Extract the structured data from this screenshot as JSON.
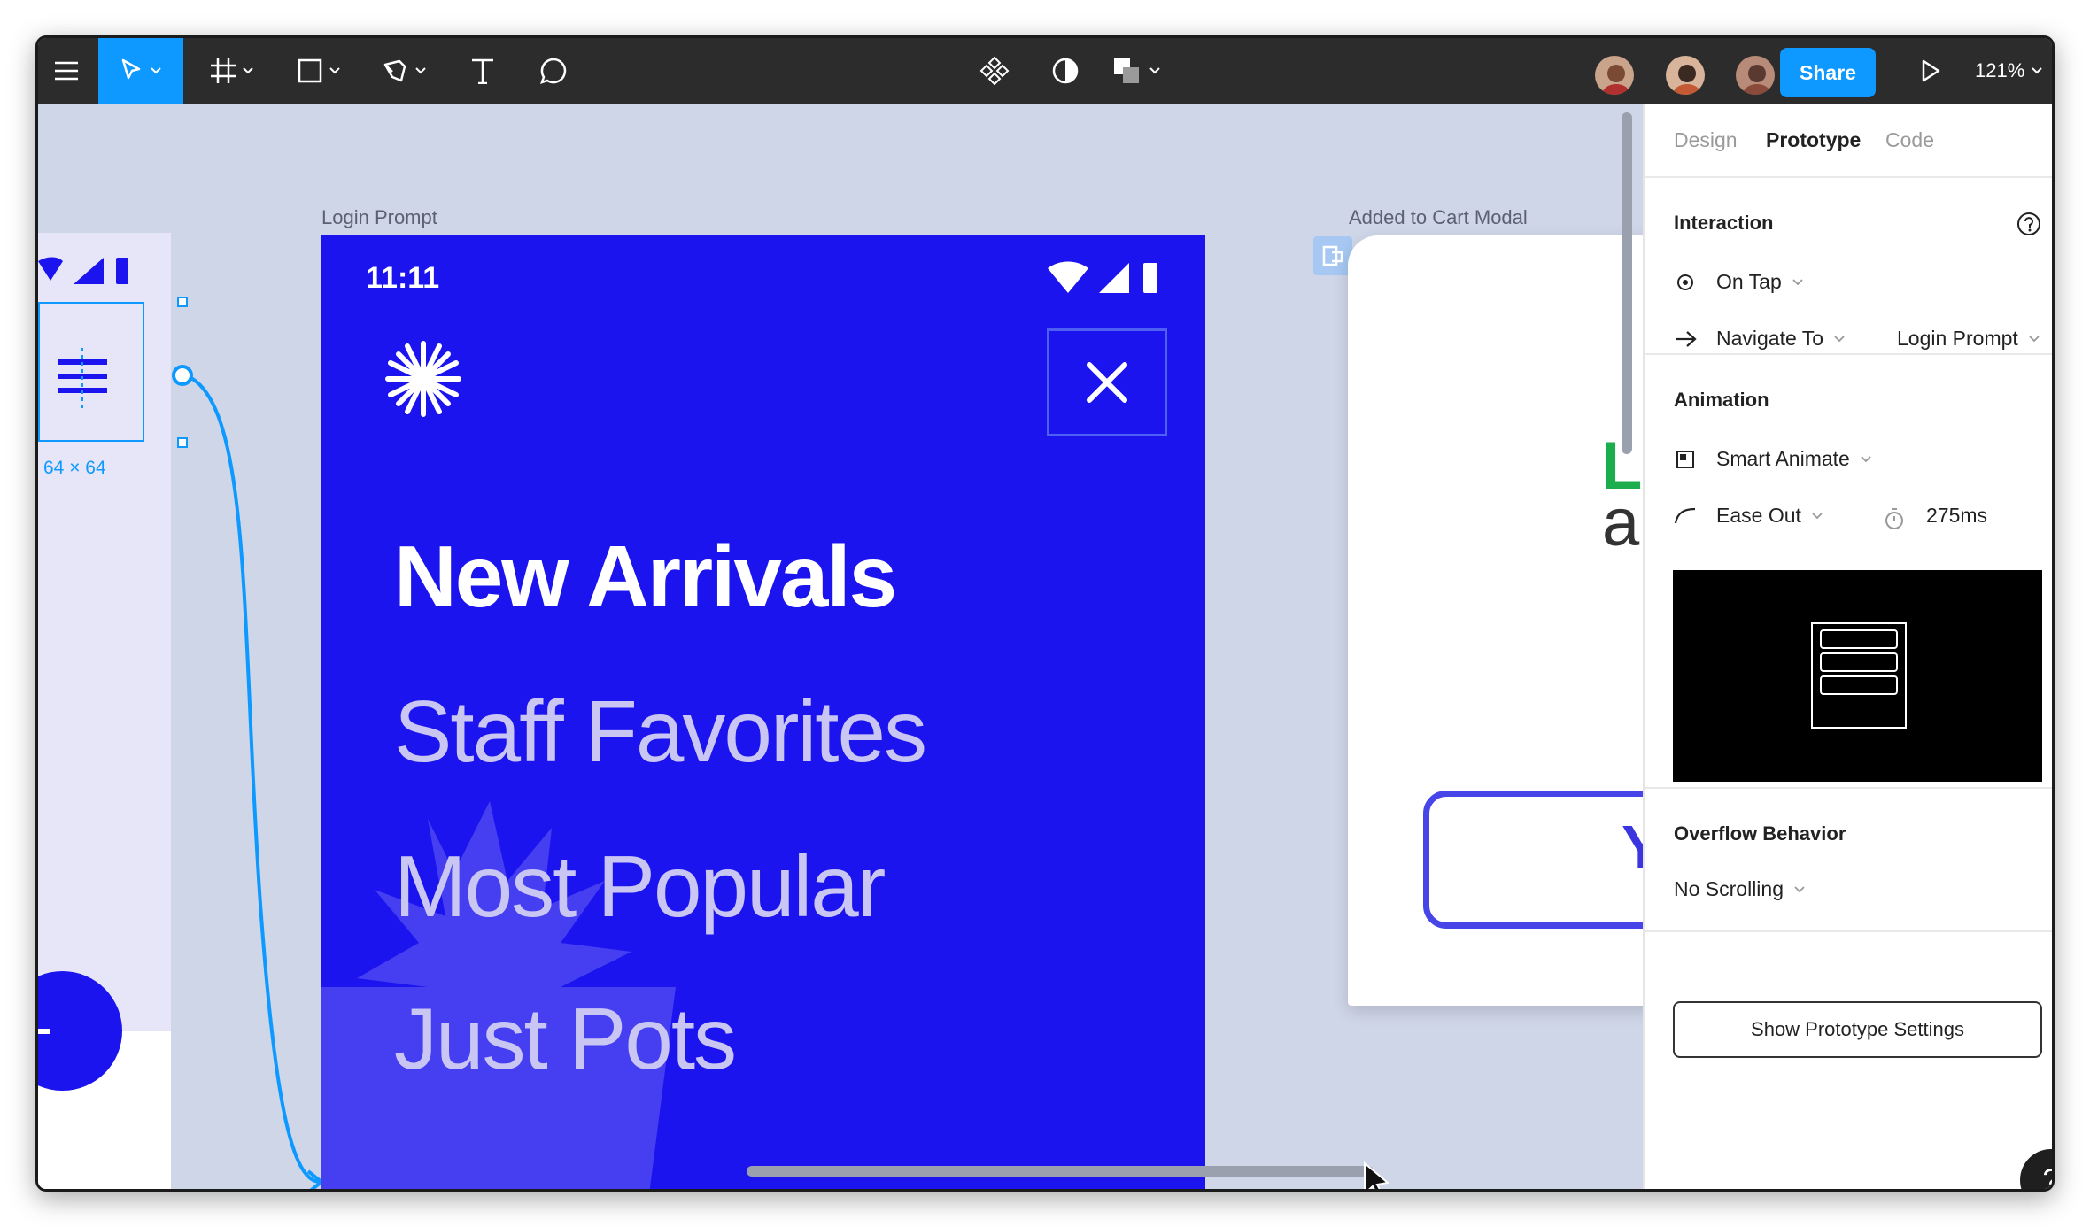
{
  "toolbar": {
    "share_label": "Share",
    "zoom_label": "121%"
  },
  "canvas": {
    "frame_labels": {
      "login_prompt": "Login Prompt",
      "added_to_cart": "Added to Cart Modal"
    },
    "selection_size": "64 × 64",
    "phone": {
      "time": "11:11",
      "menu_items": [
        "New Arrivals",
        "Staff Favorites",
        "Most Popular",
        "Just Pots"
      ]
    },
    "cart_modal": {
      "partial_green": "L",
      "partial_text": "a",
      "partial_button": "Y"
    }
  },
  "panel": {
    "tabs": [
      "Design",
      "Prototype",
      "Code"
    ],
    "interaction": {
      "title": "Interaction",
      "trigger": "On Tap",
      "action": "Navigate To",
      "destination": "Login Prompt"
    },
    "animation": {
      "title": "Animation",
      "type": "Smart Animate",
      "easing": "Ease Out",
      "duration": "275ms"
    },
    "overflow": {
      "title": "Overflow Behavior",
      "value": "No Scrolling"
    },
    "settings_button": "Show Prototype Settings"
  },
  "help_label": "?",
  "colors": {
    "accent": "#0d99ff",
    "frame_blue": "#1c14ee",
    "toolbar": "#2c2c2c",
    "canvas": "#cfd6e8"
  }
}
